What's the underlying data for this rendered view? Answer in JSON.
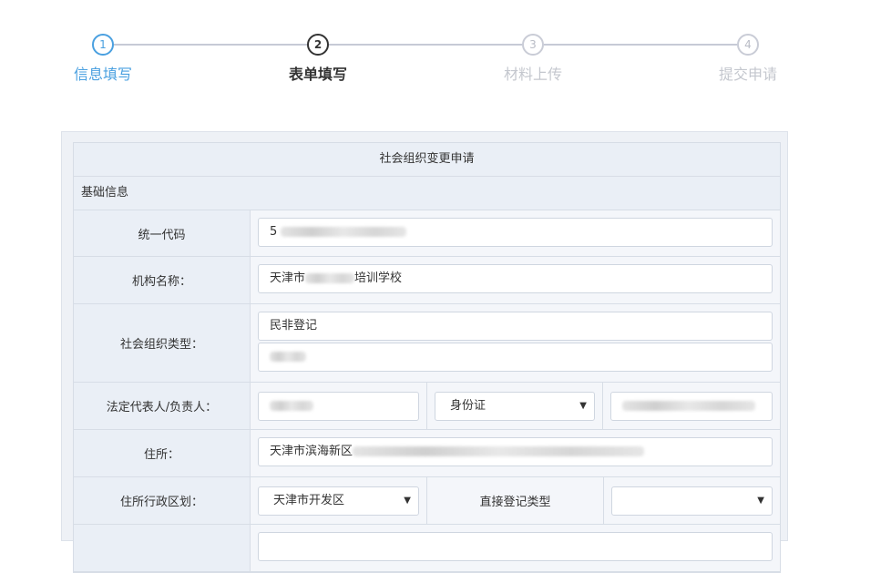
{
  "steps": [
    {
      "number": "1",
      "label": "信息填写",
      "state": "done"
    },
    {
      "number": "2",
      "label": "表单填写",
      "state": "active"
    },
    {
      "number": "3",
      "label": "材料上传",
      "state": "pending"
    },
    {
      "number": "4",
      "label": "提交申请",
      "state": "pending"
    }
  ],
  "colors": {
    "done": "#4aa0e0",
    "active": "#333333",
    "pending": "#c4c7ce"
  },
  "form": {
    "title": "社会组织变更申请",
    "section": "基础信息",
    "rows": {
      "code": {
        "label": "统一代码",
        "value_prefix": "5"
      },
      "name": {
        "label": "机构名称：",
        "value_prefix": "天津市",
        "value_suffix": "培训学校"
      },
      "org_type": {
        "label": "社会组织类型：",
        "value": "民非登记"
      },
      "legal_rep": {
        "label": "法定代表人/负责人：",
        "id_type": "身份证"
      },
      "address": {
        "label": "住所：",
        "value_prefix": "天津市滨海新区"
      },
      "district": {
        "label": "住所行政区划：",
        "value": "天津市开发区",
        "direct_label": "直接登记类型",
        "direct_value": ""
      }
    }
  }
}
